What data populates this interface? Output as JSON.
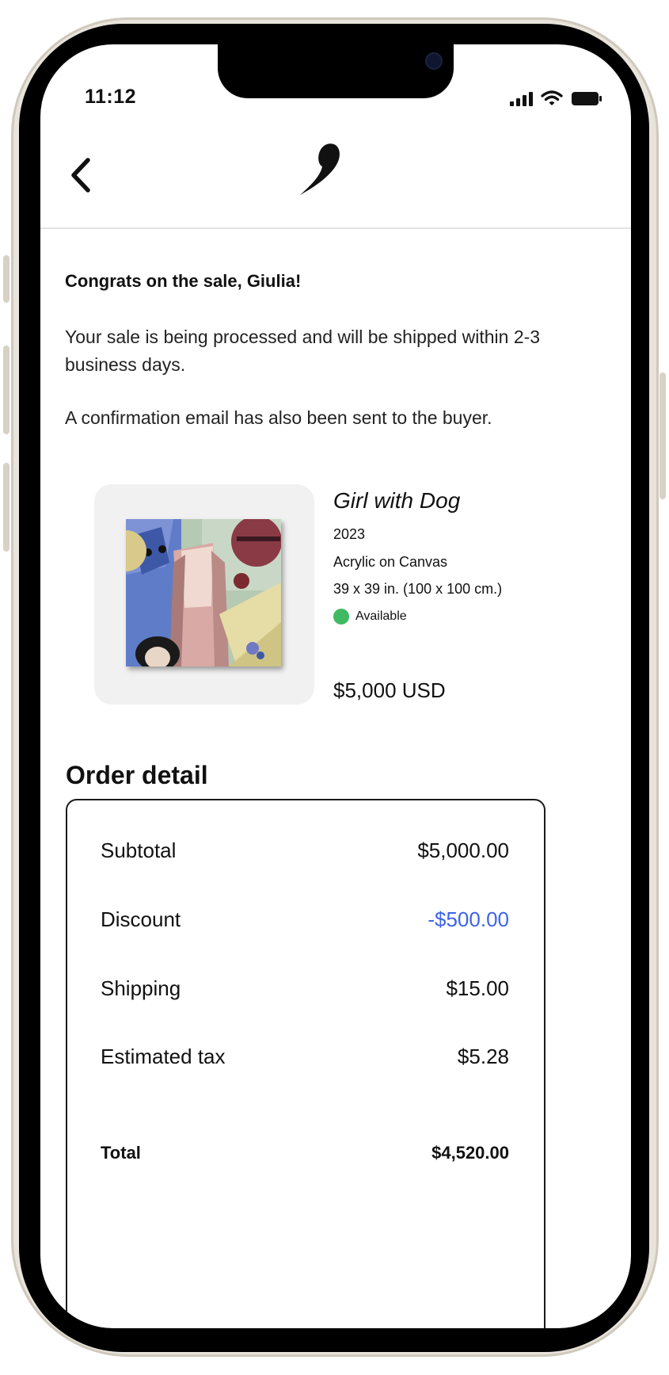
{
  "status_bar": {
    "time": "11:12"
  },
  "message": {
    "congrats": "Congrats on the sale, Giulia!",
    "processing": "Your sale is being processed and will be shipped within 2-3 business days.",
    "email_note": "A confirmation email has also been sent to the buyer."
  },
  "artwork": {
    "title": "Girl with Dog",
    "year": "2023",
    "medium": "Acrylic on Canvas",
    "dimensions": "39 x 39 in. (100 x 100 cm.)",
    "availability": "Available",
    "availability_color": "#3fba62",
    "price": "$5,000 USD"
  },
  "order": {
    "heading": "Order detail",
    "rows": [
      {
        "label": "Subtotal",
        "value": "$5,000.00"
      },
      {
        "label": "Discount",
        "value": "-$500.00",
        "color": "#3f63e8"
      },
      {
        "label": "Shipping",
        "value": "$15.00"
      },
      {
        "label": "Estimated tax",
        "value": "$5.28"
      }
    ],
    "total": {
      "label": "Total",
      "value": "$4,520.00"
    }
  },
  "icons": {
    "back": "chevron-left-icon",
    "logo": "brand-logo-icon",
    "signal": "cellular-signal-icon",
    "wifi": "wifi-icon",
    "battery": "battery-icon"
  }
}
